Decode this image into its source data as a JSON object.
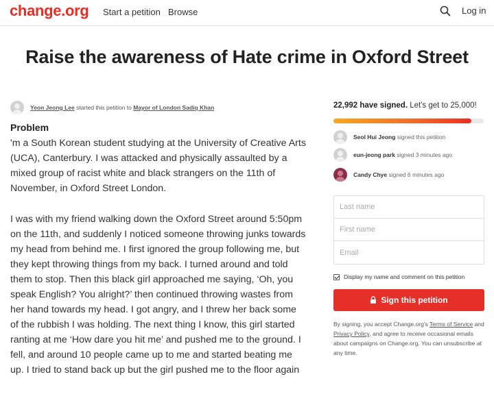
{
  "header": {
    "logo": "change.org",
    "nav": {
      "start": "Start a petition",
      "browse": "Browse"
    },
    "search_icon": "search-icon",
    "login": "Log in"
  },
  "petition": {
    "title": "Raise the awareness of Hate crime in Oxford Street",
    "starter_name": "Yeon Jeong Lee",
    "starter_middle": " started this petition to ",
    "target": "Mayor of London Sadiq Khan",
    "section_heading": "Problem",
    "paragraph1": "'m a South Korean student studying at the University of Creative Arts (UCA), Canterbury. I was attacked and physically assaulted by a mixed group of racist white and black strangers on the 11th of November, in Oxford Street London.",
    "paragraph2": "I was with my friend walking down the Oxford Street around 5:50pm on the 11th, and suddenly I noticed someone throwing junks towards my head from behind me. I first ignored the group following me, but they kept throwing things from my back. I turned around and told them to stop. Then this black girl approached me saying, ‘Oh, you speak English? You alright?’ then continued throwing wastes from her hand towards my head. I got angry, and I threw her back some of the rubbish I was holding. The next thing I know, this girl started ranting at me ‘How dare you hit me’ and pushed me to the ground. I fell, and around 10 people came up to me and started beating me up. I tried to stand back up but the girl pushed me to the floor again"
  },
  "signatures": {
    "count": "22,992 have signed.",
    "goal": " Let's get to 25,000!",
    "progress_fraction": 0.9197,
    "recent": [
      {
        "name": "Seol Hui Jeong",
        "meta": " signed this petition"
      },
      {
        "name": "eun-jeong park",
        "meta": " signed 3 minutes ago"
      },
      {
        "name": "Candy Chye",
        "meta": " signed 6 minutes ago"
      }
    ]
  },
  "form": {
    "last_name_placeholder": "Last name",
    "first_name_placeholder": "First name",
    "email_placeholder": "Email",
    "display_label": "Display my name and comment on this petition",
    "sign_button": "Sign this petition"
  },
  "legal": {
    "part1": "By signing, you accept Change.org's ",
    "terms": "Terms of Service",
    "part2": " and ",
    "privacy": "Privacy Policy",
    "part3": ", and agree to receive occasional emails about campaigns on Change.org. You can unsubscribe at any time."
  },
  "colors": {
    "brand": "#ec2c22",
    "button": "#e5302a"
  }
}
